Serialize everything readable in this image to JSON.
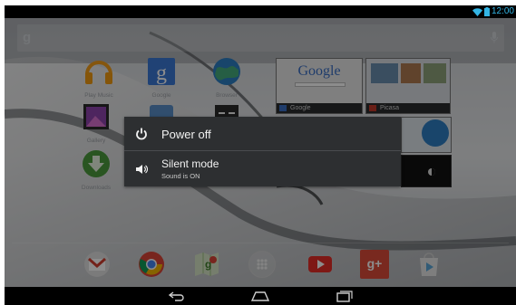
{
  "status_bar": {
    "time": "12:00",
    "icons": [
      "wifi-icon",
      "battery-icon"
    ]
  },
  "search_bar": {
    "google_glyph": "g",
    "icons": [
      "mic-icon"
    ]
  },
  "home_icons": [
    {
      "label": "Play Music",
      "icon": "headphones-icon"
    },
    {
      "label": "Google",
      "icon": "google-search-icon"
    },
    {
      "label": "Browser",
      "icon": "globe-icon"
    },
    {
      "label": "Gallery",
      "icon": "gallery-icon"
    },
    {
      "label": "Downloads",
      "icon": "download-icon"
    }
  ],
  "widgets": [
    {
      "label": "Google",
      "logo": "Google"
    },
    {
      "label": "Picasa"
    }
  ],
  "dock": {
    "icons": [
      "gmail-icon",
      "chrome-icon",
      "maps-icon",
      "all-apps-icon",
      "youtube-icon",
      "google-plus-icon",
      "play-store-icon"
    ],
    "gplus_glyph": "g+"
  },
  "nav_bar": {
    "buttons": [
      "back-icon",
      "home-icon",
      "recents-icon"
    ]
  },
  "dialog": {
    "items": [
      {
        "title": "Power off",
        "icon": "power-icon"
      },
      {
        "title": "Silent mode",
        "subtitle": "Sound is ON",
        "icon": "speaker-icon"
      }
    ]
  },
  "colors": {
    "accent": "#33b5e5",
    "dialog_bg": "#2d2f31",
    "status_bg": "#000000"
  }
}
